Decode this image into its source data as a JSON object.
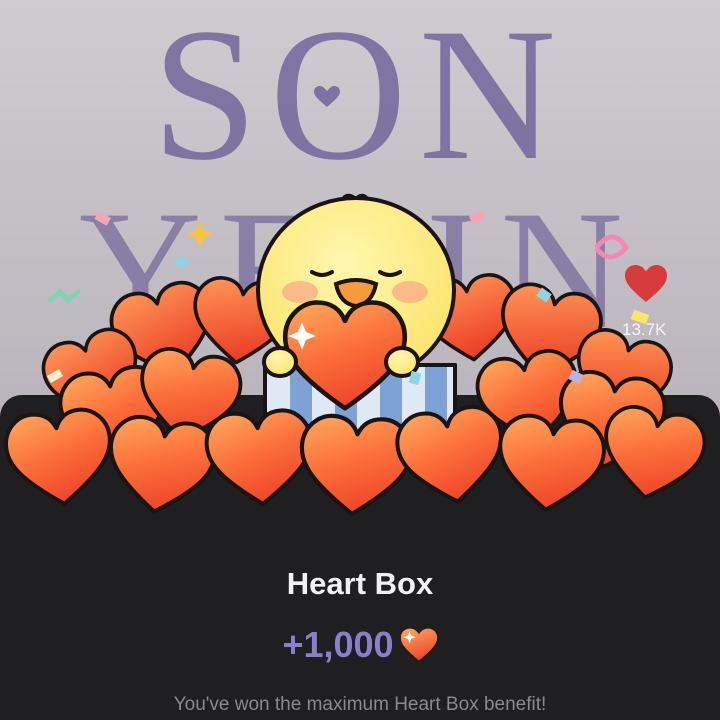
{
  "background": {
    "title_line1": "SON",
    "title_line2": "YEJIN",
    "like_count": "13.7K",
    "icons": [
      "heart-icon",
      "like-heart-icon"
    ]
  },
  "popup": {
    "title": "Heart Box",
    "reward_amount": "+1,000",
    "reward_icon": "heart-icon",
    "message": "You've won the maximum Heart Box benefit!"
  },
  "colors": {
    "accent_purple": "#8a7fc9",
    "heart_orange": "#f5572f",
    "heart_light": "#ffa95e",
    "sheet_bg": "#1f1e20",
    "like_red": "#d63a3a"
  }
}
